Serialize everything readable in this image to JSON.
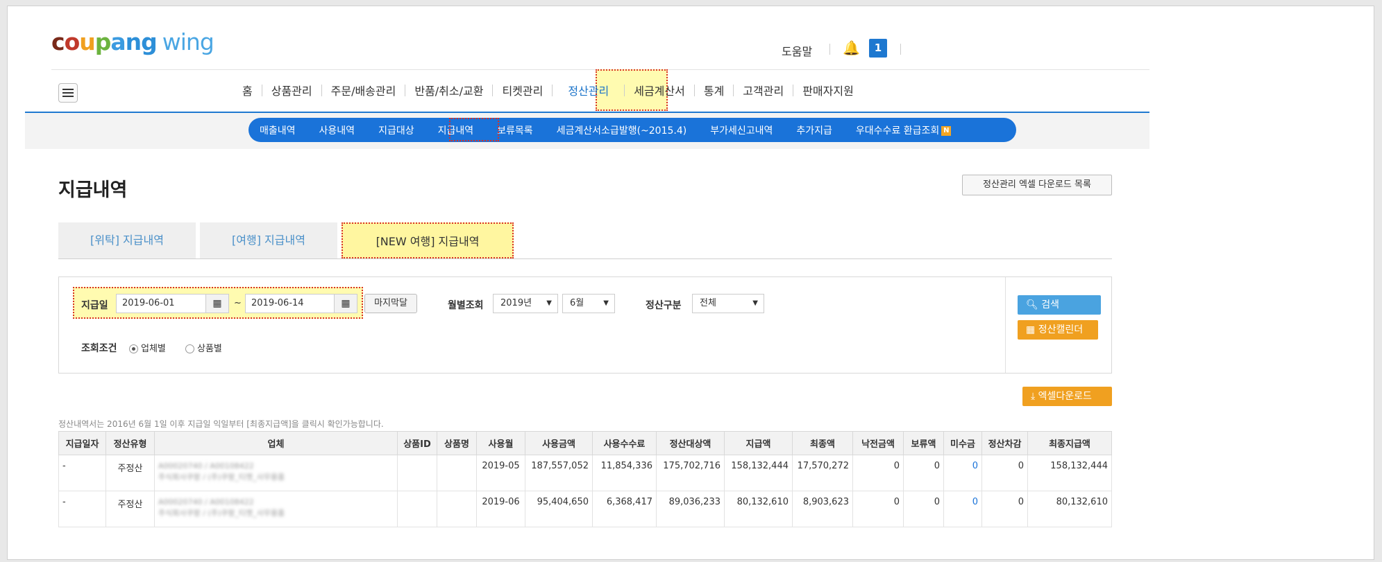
{
  "header": {
    "logo_coupang": "coupang",
    "logo_wing": "wing",
    "help": "도움말",
    "notification_count": "1"
  },
  "nav": {
    "items": [
      "홈",
      "상품관리",
      "주문/배송관리",
      "반품/취소/교환",
      "티켓관리",
      "정산관리",
      "세금계산서",
      "통계",
      "고객관리",
      "판매자지원"
    ],
    "active": "정산관리"
  },
  "subnav": {
    "items": [
      "매출내역",
      "사용내역",
      "지급대상",
      "지급내역",
      "보류목록",
      "세금계산서소급발행(~2015.4)",
      "부가세신고내역",
      "추가지급",
      "우대수수료 환급조회"
    ],
    "active": "지급내역",
    "new_badge": "N"
  },
  "page": {
    "title": "지급내역",
    "excel_list_button": "정산관리 엑셀 다운로드 목록"
  },
  "tabs": [
    "[위탁] 지급내역",
    "[여행] 지급내역",
    "[NEW 여행] 지급내역"
  ],
  "search": {
    "date_label": "지급일",
    "date_from": "2019-06-01",
    "date_to": "2019-06-14",
    "tilde": "~",
    "last_close_button": "마지막달",
    "monthly_label": "월별조회",
    "year_value": "2019년",
    "month_value": "6월",
    "settle_type_label": "정산구분",
    "settle_type_value": "전체",
    "condition_label": "조회조건",
    "radio_vendor": "업체별",
    "radio_product": "상품별",
    "search_button": "검색",
    "calendar_button": "정산캘린더"
  },
  "excel_download_button": "엑셀다운로드",
  "note": "정산내역서는 2016년 6월 1일 이후 지급일 익일부터 [최종지급액]을 클릭시 확인가능합니다.",
  "table": {
    "columns": [
      "지급일자",
      "정산유형",
      "업체",
      "상품ID",
      "상품명",
      "사용월",
      "사용금액",
      "사용수수료",
      "정산대상액",
      "지급액",
      "최종액",
      "낙전금액",
      "보류액",
      "미수금",
      "정산차감",
      "최종지급액"
    ],
    "rows": [
      {
        "date": "-",
        "type": "주정산",
        "vendor_line1": "A00020740 / A00108422",
        "vendor_line2": "주식회사쿠팡 / (주)쿠팡_티켓_사무용품",
        "product_id": "",
        "product_name": "",
        "month": "2019-05",
        "amount": "187,557,052",
        "fee": "11,854,336",
        "target": "175,702,716",
        "paid": "158,132,444",
        "final": "17,570,272",
        "lapsed": "0",
        "hold": "0",
        "unpaid": "0",
        "deduct": "0",
        "final_paid": "158,132,444"
      },
      {
        "date": "-",
        "type": "주정산",
        "vendor_line1": "A00020740 / A00108422",
        "vendor_line2": "주식회사쿠팡 / (주)쿠팡_티켓_사무용품",
        "product_id": "",
        "product_name": "",
        "month": "2019-06",
        "amount": "95,404,650",
        "fee": "6,368,417",
        "target": "89,036,233",
        "paid": "80,132,610",
        "final": "8,903,623",
        "lapsed": "0",
        "hold": "0",
        "unpaid": "0",
        "deduct": "0",
        "final_paid": "80,132,610"
      }
    ]
  }
}
